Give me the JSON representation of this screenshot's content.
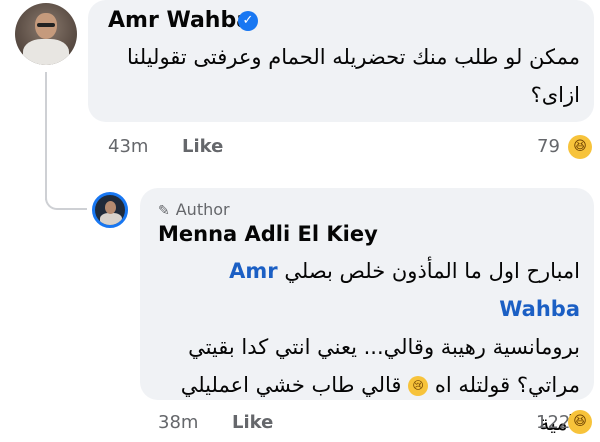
{
  "comment": {
    "author": "Amr Wahba",
    "text_line1": "ممكن لو طلب منك تحضريله الحمام وعرفتى تقوليلنا",
    "text_line2": "ازاى؟",
    "time": "43m",
    "like_label": "Like",
    "reaction_count": "79",
    "reaction_icon": "laughing-emoji-icon"
  },
  "reply": {
    "badge": "Author",
    "author": "Menna Adli El Kiey",
    "mention": "Amr Wahba",
    "text_line1": "امبارح اول ما المأذون خلص بصلي",
    "text_line2": "برومانسية رهيبة وقالي... يعني انتي كدا بقيتي",
    "text_line3a": "مراتي؟ قولتله اه",
    "text_line3b": "قالي طاب خشي اعمليلي",
    "text_line4": "بامية",
    "time": "38m",
    "like_label": "Like",
    "reaction_count": "122",
    "reaction_icon": "laughing-emoji-icon"
  },
  "colors": {
    "bubble": "#f0f2f5",
    "verified": "#1877f2",
    "mention": "#1b5fc4",
    "meta": "#65676b"
  }
}
